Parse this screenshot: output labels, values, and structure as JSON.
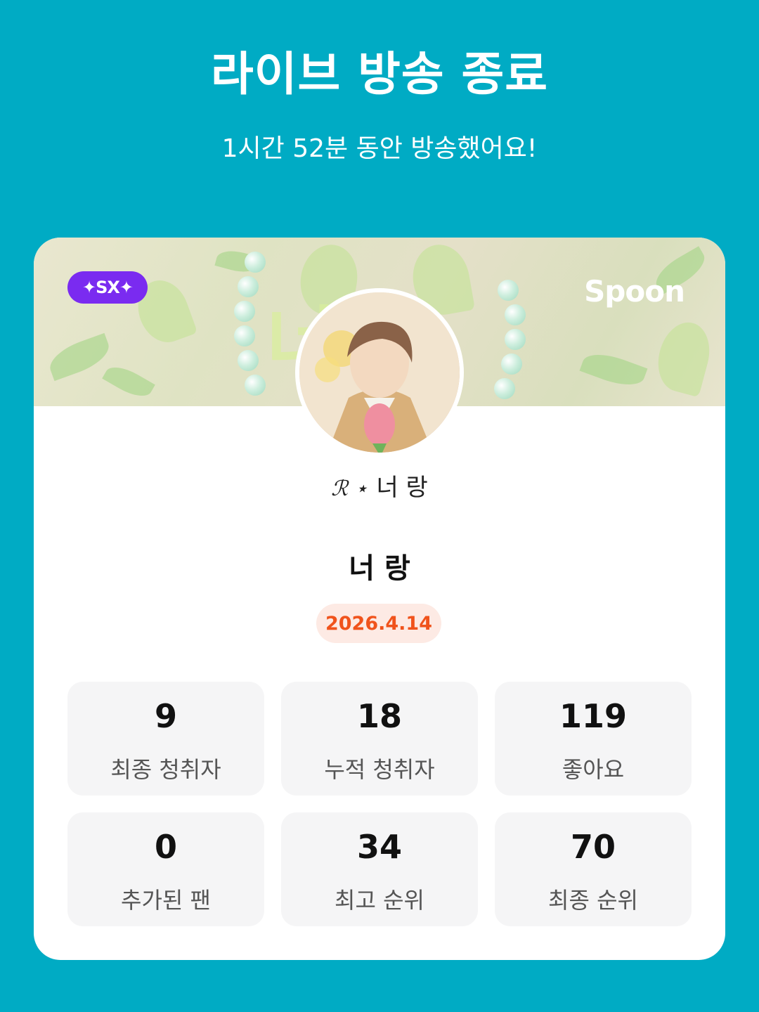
{
  "header": {
    "title": "라이브 방송 종료",
    "subtitle": "1시간 52분 동안 방송했어요!"
  },
  "card": {
    "badge": "✦SX✦",
    "logo": "Spoon",
    "nickname_deco": "ℛ ⋆",
    "nickname": "너 랑",
    "room_title": "너 랑",
    "date": "2026.4.14"
  },
  "stats": [
    {
      "value": "9",
      "label": "최종 청취자"
    },
    {
      "value": "18",
      "label": "누적 청취자"
    },
    {
      "value": "119",
      "label": "좋아요"
    },
    {
      "value": "0",
      "label": "추가된 팬"
    },
    {
      "value": "34",
      "label": "최고 순위"
    },
    {
      "value": "70",
      "label": "최종 순위"
    }
  ],
  "colors": {
    "background": "#00abc4",
    "badge": "#7a2bf0",
    "date_text": "#f0531c",
    "date_bg": "#fdeae4"
  }
}
